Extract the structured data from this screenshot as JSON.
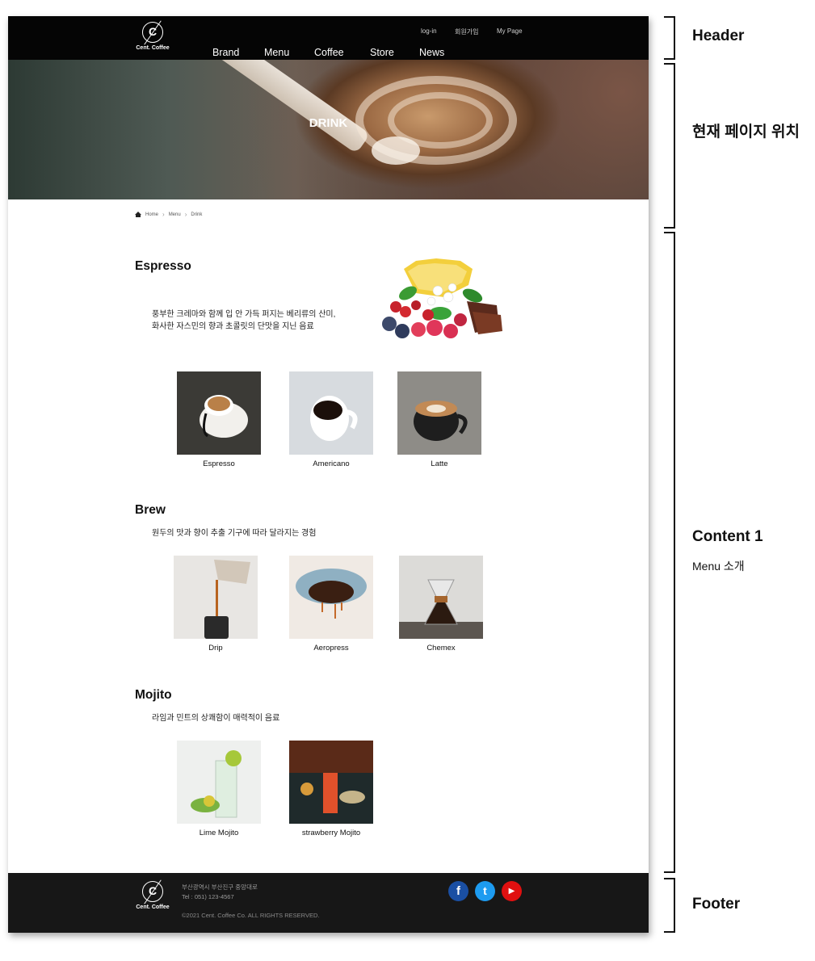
{
  "header": {
    "logo_text": "Cent. Coffee",
    "logo_letter": "C",
    "util_links": [
      "log-in",
      "회원가입",
      "My Page"
    ],
    "nav": [
      "Brand",
      "Menu",
      "Coffee",
      "Store",
      "News"
    ]
  },
  "hero": {
    "title": "DRINK"
  },
  "breadcrumb": [
    "Home",
    "Menu",
    "Drink"
  ],
  "sections": [
    {
      "title": "Espresso",
      "desc_lines": [
        "풍부한 크레마와 함께 입 안 가득 퍼지는 베리류의 산미,",
        "화사한 자스민의 향과 초콜릿의 단맛을 지닌 음료"
      ],
      "items": [
        "Espresso",
        "Americano",
        "Latte"
      ]
    },
    {
      "title": "Brew",
      "desc_lines": [
        "원두의 맛과 향이 추출 기구에 따라 달라지는 경험"
      ],
      "items": [
        "Drip",
        "Aeropress",
        "Chemex"
      ]
    },
    {
      "title": "Mojito",
      "desc_lines": [
        "라임과 민트의 상쾌함이 매력적이 음료"
      ],
      "items": [
        "Lime Mojito",
        "strawberry  Mojito"
      ]
    }
  ],
  "footer": {
    "logo_text": "Cent. Coffee",
    "logo_letter": "C",
    "address": "부산광역시 부산진구 중앙대로",
    "tel": "Tel : 051) 123-4567",
    "copyright": "©2021 Cent. Coffee Co. ALL RIGHTS RESERVED.",
    "social": [
      {
        "icon": "facebook-icon",
        "glyph": "f",
        "color": "#1a4fa3"
      },
      {
        "icon": "twitter-icon",
        "glyph": "t",
        "color": "#1d9bf0"
      },
      {
        "icon": "youtube-icon",
        "glyph": "▶",
        "color": "#e01010"
      }
    ]
  },
  "annotations": {
    "header": "Header",
    "location": "현재 페이지 위치",
    "content": "Content 1",
    "content_sub": "Menu 소개",
    "footer": "Footer"
  }
}
